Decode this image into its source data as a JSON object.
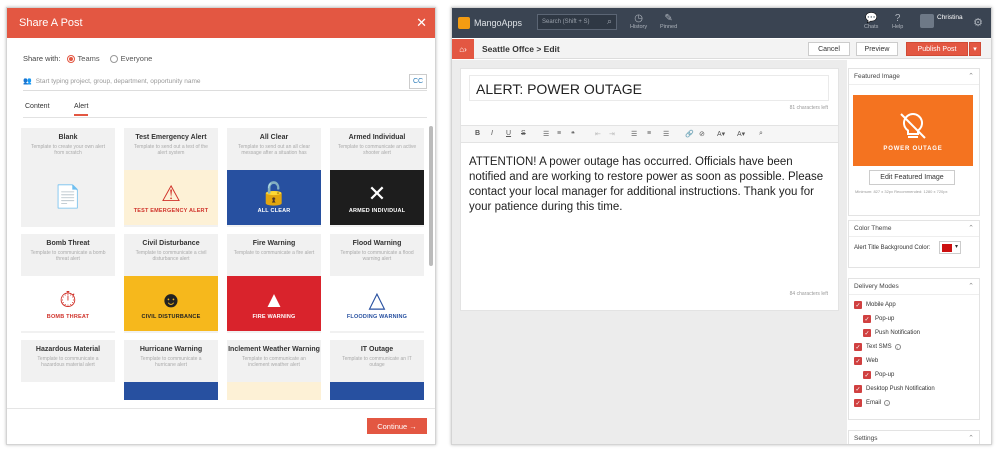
{
  "left": {
    "title": "Share A Post",
    "share_with_label": "Share with:",
    "options": [
      "Teams",
      "Everyone"
    ],
    "search_placeholder": "Start typing project, group, department, opportunity name",
    "cc_label": "CC",
    "tabs": [
      "Content",
      "Alert"
    ],
    "continue_label": "Continue →",
    "cards": [
      {
        "title": "Blank",
        "desc": "Template to create your own alert from scratch",
        "caption": "",
        "bg": "#f1f1f1",
        "fg": "#555",
        "icon": "📄"
      },
      {
        "title": "Test Emergency Alert",
        "desc": "Template to send out a test of the alert system",
        "caption": "TEST EMERGENCY ALERT",
        "bg": "#fdf1d6",
        "fg": "#d0332b",
        "icon": "⚠"
      },
      {
        "title": "All Clear",
        "desc": "Template to send out an all clear message after a situation has",
        "caption": "ALL CLEAR",
        "bg": "#2750a0",
        "fg": "#ffffff",
        "icon": "🔓"
      },
      {
        "title": "Armed Individual",
        "desc": "Template to communicate an active shooter alert",
        "caption": "ARMED INDIVIDUAL",
        "bg": "#1d1d1d",
        "fg": "#ffffff",
        "icon": "✕"
      },
      {
        "title": "Bomb Threat",
        "desc": "Template to communicate a bomb threat alert",
        "caption": "BOMB THREAT",
        "bg": "#ffffff",
        "fg": "#d0332b",
        "icon": "⏱"
      },
      {
        "title": "Civil Disturbance",
        "desc": "Template to communicate a civil disturbance alert",
        "caption": "CIVIL DISTURBANCE",
        "bg": "#f6b81c",
        "fg": "#222222",
        "icon": "☻"
      },
      {
        "title": "Fire Warning",
        "desc": "Template to communicate a fire alert",
        "caption": "FIRE WARNING",
        "bg": "#d9232c",
        "fg": "#ffffff",
        "icon": "▲"
      },
      {
        "title": "Flood Warning",
        "desc": "Template to communicate a flood warning alert",
        "caption": "FLOODING WARNING",
        "bg": "#ffffff",
        "fg": "#2750a0",
        "icon": "△"
      },
      {
        "title": "Hazardous Material",
        "desc": "Template to communicate a hazardous material alert",
        "caption": "",
        "bg": "#ffffff",
        "fg": "#333",
        "icon": ""
      },
      {
        "title": "Hurricane Warning",
        "desc": "Template to communicate a hurricane alert",
        "caption": "",
        "bg": "#2750a0",
        "fg": "#fff",
        "icon": ""
      },
      {
        "title": "Inclement Weather Warning",
        "desc": "Template to communicate an inclement weather alert",
        "caption": "",
        "bg": "#fdf1d6",
        "fg": "#333",
        "icon": ""
      },
      {
        "title": "IT Outage",
        "desc": "Template to communicate an IT outage",
        "caption": "",
        "bg": "#2750a0",
        "fg": "#fff",
        "icon": ""
      }
    ]
  },
  "right": {
    "app_name": "MangoApps",
    "search_placeholder": "Search (Shift + S)",
    "top_icons": [
      "History",
      "Pinned",
      "Chats",
      "Help"
    ],
    "user_name": "Christina",
    "breadcrumb": "Seattle Offce > Edit",
    "cancel_label": "Cancel",
    "preview_label": "Preview",
    "publish_label": "Publish Post",
    "post_title": "ALERT: POWER OUTAGE",
    "title_count": "81 characters left",
    "body_text": "ATTENTION! A power outage has occurred. Officials have been notified and are working to restore power as soon as possible. Please contact your local manager for additional instructions. Thank you for your patience during this time.",
    "body_count": "84 characters left",
    "featured_image_heading": "Featured Image",
    "featured_image_caption": "POWER OUTAGE",
    "edit_featured_label": "Edit Featured Image",
    "image_note": "Minimum: 827 x 32px  Recommended: 1280 x 720px",
    "color_theme_heading": "Color Theme",
    "alert_bg_label": "Alert Title Background Color:",
    "alert_color": "#cc1010",
    "delivery_heading": "Delivery Modes",
    "delivery": [
      {
        "label": "Mobile App",
        "indent": 0,
        "info": false
      },
      {
        "label": "Pop-up",
        "indent": 1,
        "info": false
      },
      {
        "label": "Push Notification",
        "indent": 1,
        "info": false
      },
      {
        "label": "Text SMS",
        "indent": 0,
        "info": true
      },
      {
        "label": "Web",
        "indent": 0,
        "info": false
      },
      {
        "label": "Pop-up",
        "indent": 1,
        "info": false
      },
      {
        "label": "Desktop Push Notification",
        "indent": 0,
        "info": false
      },
      {
        "label": "Email",
        "indent": 0,
        "info": true
      }
    ],
    "settings_heading": "Settings"
  }
}
